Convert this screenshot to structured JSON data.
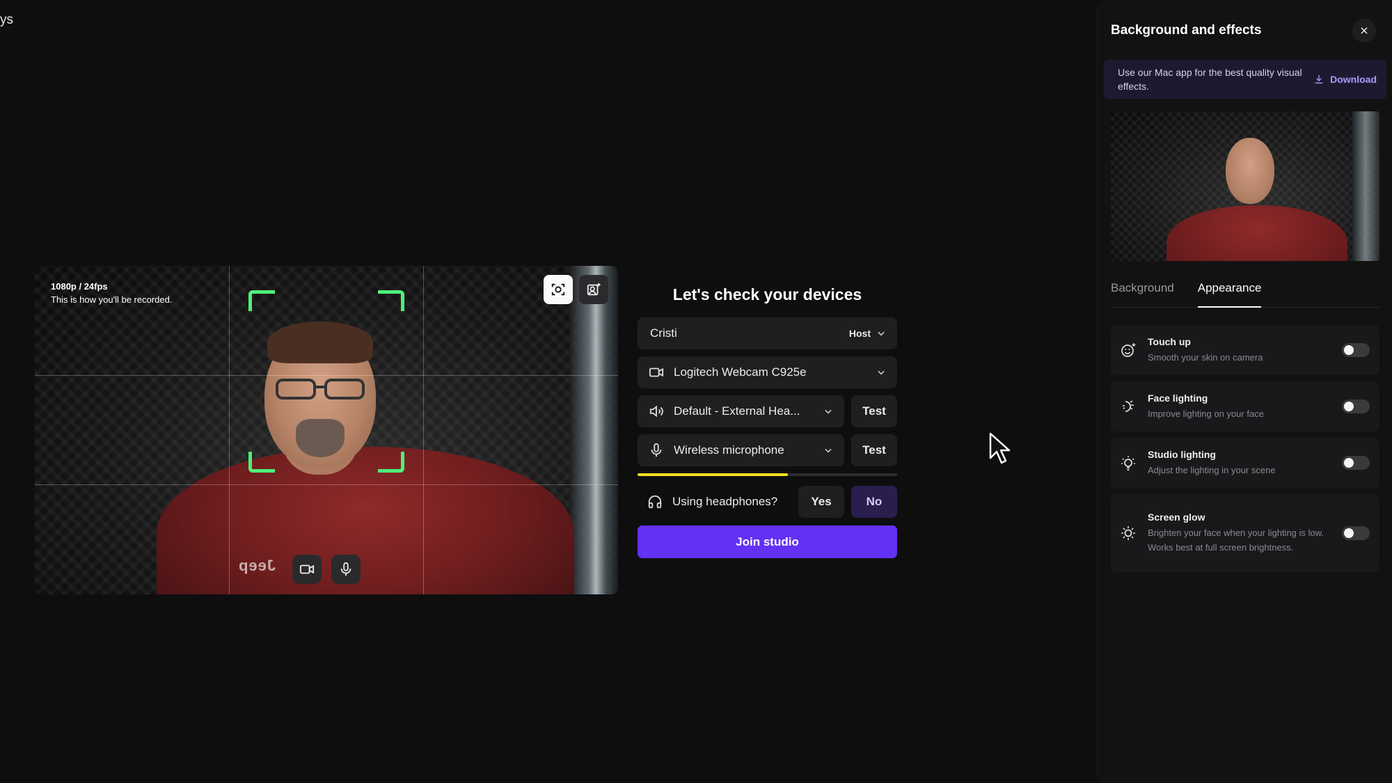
{
  "corner_text": "ys",
  "preview": {
    "resolution": "1080p / 24fps",
    "note": "This is how you'll be recorded.",
    "shirt_logo": "Jeep"
  },
  "devices": {
    "title": "Let's check your devices",
    "name_value": "Cristi",
    "role": "Host",
    "camera": "Logitech Webcam C925e",
    "speaker": "Default - External Hea...",
    "microphone": "Wireless microphone",
    "test_label": "Test",
    "mic_level": 0.58,
    "headphones_question": "Using headphones?",
    "yes_label": "Yes",
    "no_label": "No",
    "join_label": "Join studio"
  },
  "panel": {
    "title": "Background and effects",
    "banner_text": "Use our Mac app for the best quality visual effects.",
    "download_label": "Download",
    "tabs": [
      {
        "label": "Background",
        "active": false
      },
      {
        "label": "Appearance",
        "active": true
      }
    ],
    "effects": [
      {
        "title": "Touch up",
        "desc": "Smooth your skin on camera",
        "enabled": false,
        "icon": "smile-sparkle-icon"
      },
      {
        "title": "Face lighting",
        "desc": "Improve lighting on your face",
        "enabled": false,
        "icon": "face-light-icon"
      },
      {
        "title": "Studio lighting",
        "desc": "Adjust the lighting in your scene",
        "enabled": false,
        "icon": "bulb-icon"
      },
      {
        "title": "Screen glow",
        "desc": "Brighten your face when your lighting is low. Works best at full screen brightness.",
        "enabled": false,
        "icon": "sun-icon"
      }
    ]
  },
  "colors": {
    "accent": "#6331f3",
    "focus_bracket": "#4ff07a",
    "level": "#f3e11f"
  }
}
